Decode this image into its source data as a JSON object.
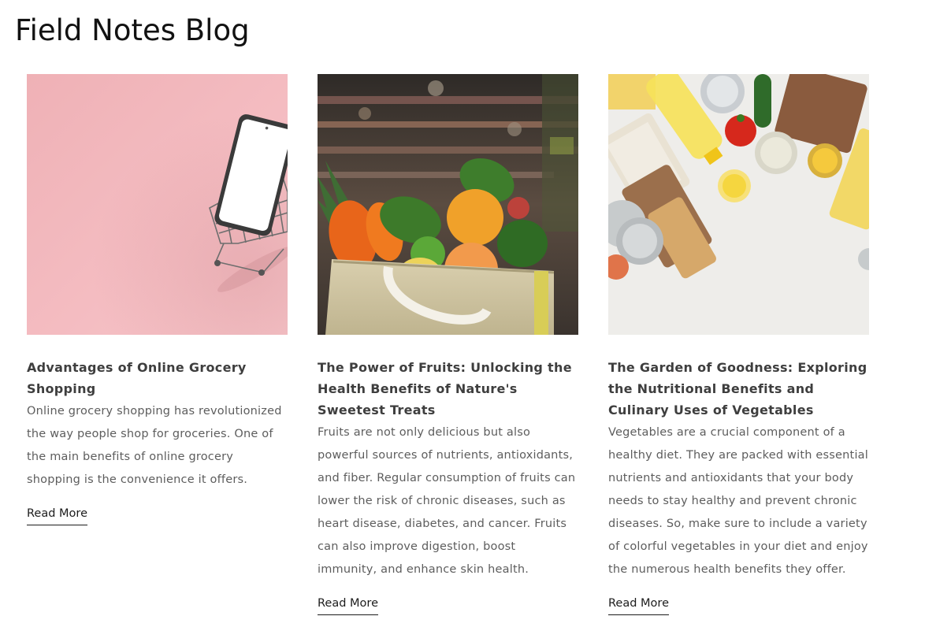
{
  "blog": {
    "title": "Field Notes Blog"
  },
  "articles": [
    {
      "title": "Advantages of Online Grocery Shopping",
      "excerpt": "Online grocery shopping has revolutionized the way people shop for groceries. One of the main benefits of online grocery shopping is the convenience it offers.",
      "read_more": "Read More",
      "image_icon": "phone-in-shopping-cart-image"
    },
    {
      "title": "The Power of Fruits: Unlocking the Health Benefits of Nature's Sweetest Treats",
      "excerpt": "Fruits are not only delicious but also powerful sources of nutrients, antioxidants, and fiber. Regular consumption of fruits can lower the risk of chronic diseases, such as heart disease, diabetes, and cancer. Fruits can also improve digestion, boost immunity, and enhance skin health.",
      "read_more": "Read More",
      "image_icon": "fruit-grocery-bag-image"
    },
    {
      "title": "The Garden of Goodness: Exploring the Nutritional Benefits and Culinary Uses of Vegetables",
      "excerpt": "Vegetables are a crucial component of a healthy diet. They are packed with essential nutrients and antioxidants that your body needs to stay healthy and prevent chronic diseases. So, make sure to include a variety of colorful vegetables in your diet and enjoy the numerous health benefits they offer.",
      "read_more": "Read More",
      "image_icon": "pantry-groceries-flatlay-image"
    }
  ],
  "colors": {
    "heading": "#121212",
    "card_title": "#3e3e3e",
    "body_text": "#5d5d5d",
    "link": "#1c1c1c",
    "pink_background": "#f2b8bd"
  }
}
